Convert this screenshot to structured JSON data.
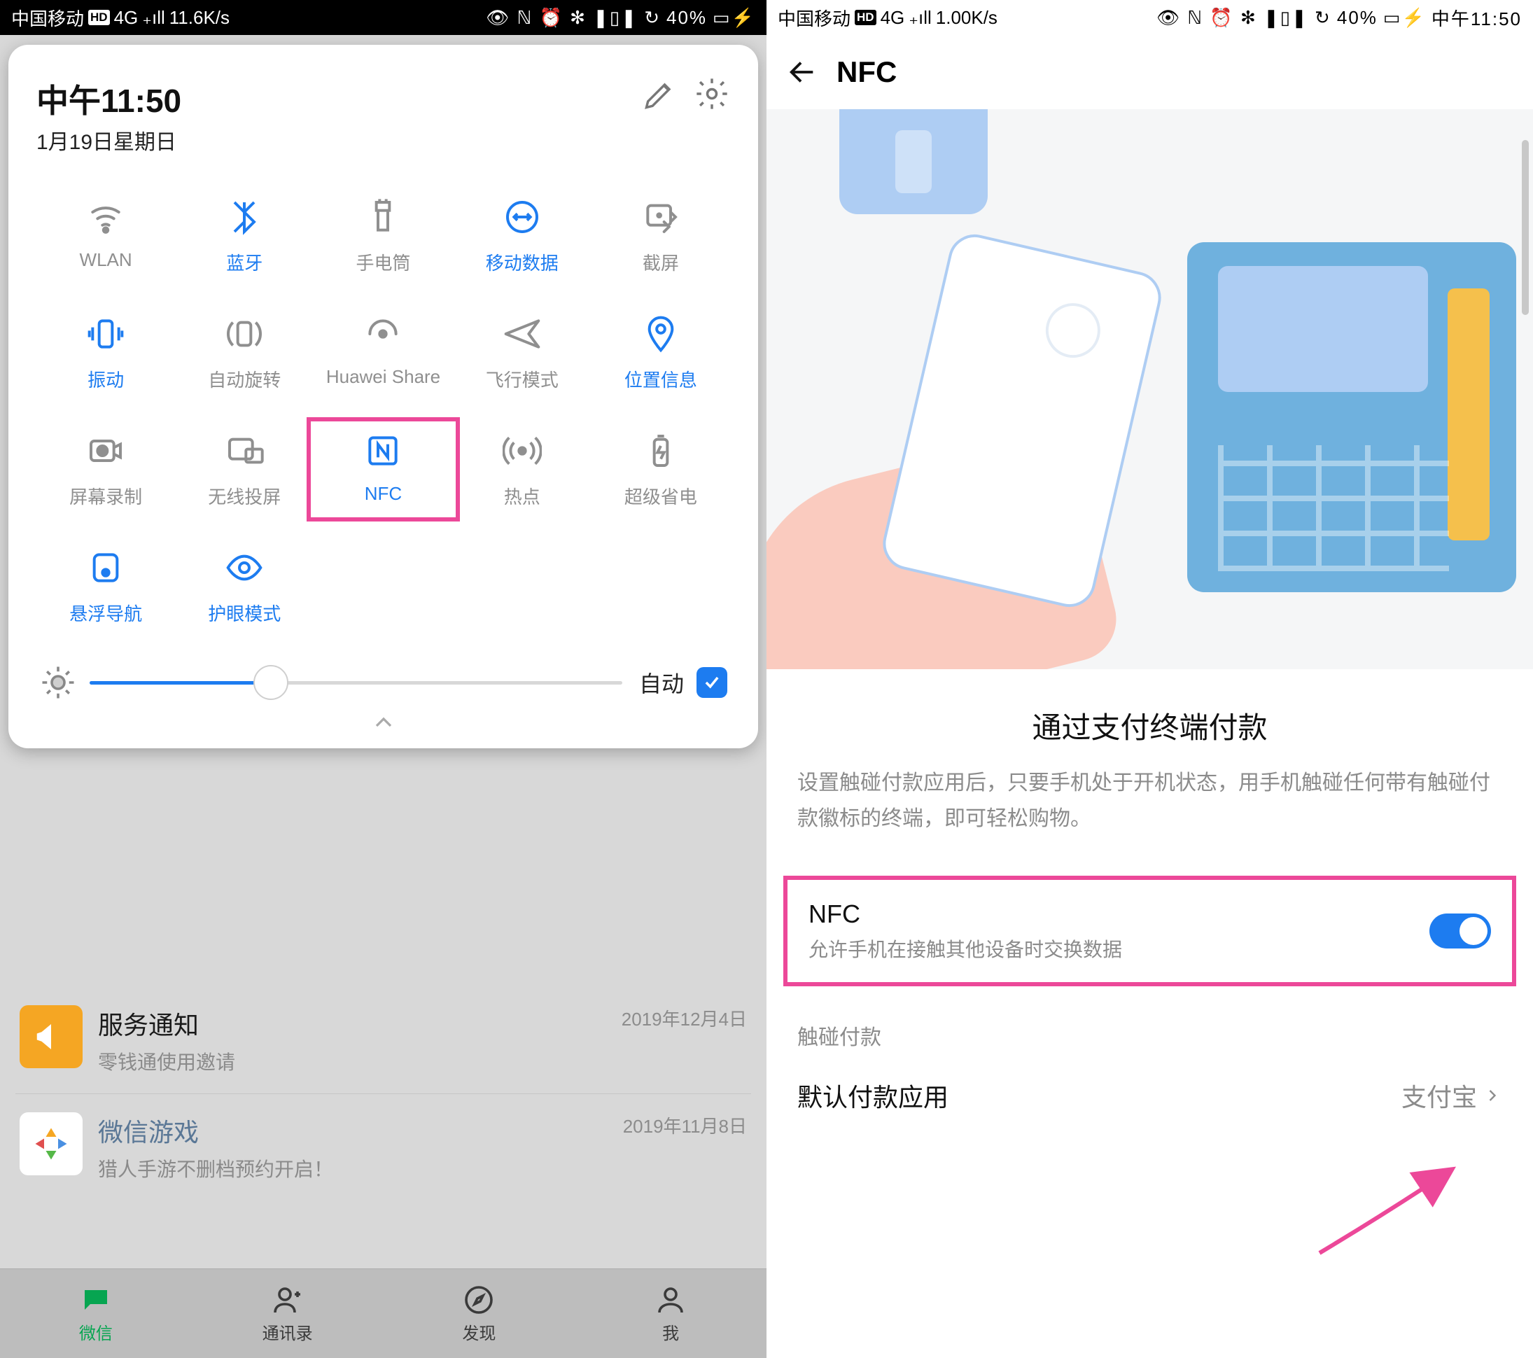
{
  "left": {
    "status": {
      "carrier": "中国移动",
      "hd": "HD",
      "net": "4G",
      "speed": "11.6K/s",
      "battery": "40%",
      "icons": "👁 ℕ ⏰ ✻ ❚▯❚ ↻"
    },
    "time": "中午11:50",
    "date": "1月19日星期日",
    "tiles": [
      {
        "label": "WLAN",
        "on": false,
        "icon": "wifi"
      },
      {
        "label": "蓝牙",
        "on": true,
        "icon": "bt"
      },
      {
        "label": "手电筒",
        "on": false,
        "icon": "torch"
      },
      {
        "label": "移动数据",
        "on": true,
        "icon": "data"
      },
      {
        "label": "截屏",
        "on": false,
        "icon": "shot"
      },
      {
        "label": "振动",
        "on": true,
        "icon": "vib"
      },
      {
        "label": "自动旋转",
        "on": false,
        "icon": "rot"
      },
      {
        "label": "Huawei Share",
        "on": false,
        "icon": "share"
      },
      {
        "label": "飞行模式",
        "on": false,
        "icon": "plane"
      },
      {
        "label": "位置信息",
        "on": true,
        "icon": "loc"
      },
      {
        "label": "屏幕录制",
        "on": false,
        "icon": "rec"
      },
      {
        "label": "无线投屏",
        "on": false,
        "icon": "cast"
      },
      {
        "label": "NFC",
        "on": true,
        "icon": "nfc",
        "hilite": true
      },
      {
        "label": "热点",
        "on": false,
        "icon": "hot"
      },
      {
        "label": "超级省电",
        "on": false,
        "icon": "batt"
      },
      {
        "label": "悬浮导航",
        "on": true,
        "icon": "float"
      },
      {
        "label": "护眼模式",
        "on": true,
        "icon": "eye"
      }
    ],
    "brightness_auto": "自动",
    "notifs": [
      {
        "title": "服务通知",
        "sub": "零钱通使用邀请",
        "date": "2019年12月4日"
      },
      {
        "title": "微信游戏",
        "sub": "猎人手游不删档预约开启！",
        "date": "2019年11月8日"
      }
    ],
    "tabs": [
      {
        "l": "微信"
      },
      {
        "l": "通讯录"
      },
      {
        "l": "发现"
      },
      {
        "l": "我"
      }
    ]
  },
  "right": {
    "status": {
      "carrier": "中国移动",
      "hd": "HD",
      "net": "4G",
      "speed": "1.00K/s",
      "battery": "40%",
      "time": "中午11:50",
      "icons": "👁 ℕ ⏰ ✻ ❚▯❚ ↻"
    },
    "header": "NFC",
    "info_title": "通过支付终端付款",
    "info_desc": "设置触碰付款应用后，只要手机处于开机状态，用手机触碰任何带有触碰付款徽标的终端，即可轻松购物。",
    "nfc_title": "NFC",
    "nfc_sub": "允许手机在接触其他设备时交换数据",
    "section": "触碰付款",
    "row_label": "默认付款应用",
    "row_value": "支付宝"
  }
}
